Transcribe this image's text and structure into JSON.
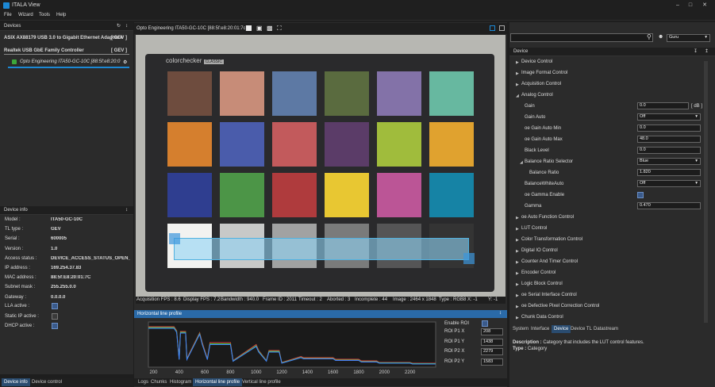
{
  "app": {
    "title": "ITALA View"
  },
  "menu": [
    "File",
    "Wizard",
    "Tools",
    "Help"
  ],
  "devices_panel": {
    "title": "Devices",
    "adapters": [
      {
        "name": "ASIX AX88179 USB 3.0 to Gigabit Ethernet Adapter #",
        "tag": "[ GEV ]"
      },
      {
        "name": "Realtek USB GbE Family Controller",
        "tag": "[ GEV ]"
      }
    ],
    "camera": "Opto Engineering ITA50-GC-10C [88:5f:e8:20:0"
  },
  "device_info": {
    "title": "Device info",
    "rows": [
      {
        "label": "Model :",
        "value": "ITA50-GC-10C"
      },
      {
        "label": "TL type :",
        "value": "GEV"
      },
      {
        "label": "Serial :",
        "value": "600005"
      },
      {
        "label": "Version :",
        "value": "1.0"
      },
      {
        "label": "Access status :",
        "value": "DEVICE_ACCESS_STATUS_OPEN_REA("
      },
      {
        "label": "IP address :",
        "value": "169.254.37.83"
      },
      {
        "label": "MAC address :",
        "value": "88:5f:E8:20:01:7C"
      },
      {
        "label": "Subnet mask :",
        "value": "255.255.0.0"
      },
      {
        "label": "Gateway :",
        "value": "0.0.0.0"
      }
    ],
    "checks": [
      {
        "label": "LLA active :",
        "checked": true
      },
      {
        "label": "Static IP active :",
        "checked": false
      },
      {
        "label": "DHCP active :",
        "checked": true
      }
    ]
  },
  "left_tabs": [
    "Device info",
    "Device control"
  ],
  "viewer": {
    "title": "Opto Engineering ITA50-GC-10C [88:5f:e8:20:01:7c]",
    "brand_text": "colorchecker",
    "brand_badge": "CLASSIC",
    "status": {
      "acq_fps": "Acquisition FPS : 8.6",
      "disp_fps": "Display FPS : 7.2",
      "bandwidth": "Bandwidth : 940.0",
      "frame_id": "Frame ID : 2011",
      "timeout": "Timeout : 2",
      "aborted": "Aborted : 3",
      "incomplete": "Incomplete : 44",
      "image": "Image : 2464 x 1848",
      "type": "Type : RGB8",
      "x": "X: -1",
      "y": "Y: -1"
    }
  },
  "profile": {
    "title": "Horizontal line profile",
    "enable_label": "Enable ROI",
    "enabled": true,
    "fields": [
      {
        "label": "ROI P1 X",
        "value": "208"
      },
      {
        "label": "ROI P1 Y",
        "value": "1438"
      },
      {
        "label": "ROI P2 X",
        "value": "2279"
      },
      {
        "label": "ROI P2 Y",
        "value": "1583"
      }
    ],
    "x_ticks": [
      "200",
      "400",
      "600",
      "800",
      "1000",
      "1200",
      "1400",
      "1600",
      "1800",
      "2000",
      "2200"
    ]
  },
  "bottom_tabs": [
    "Logs",
    "Chunks",
    "Histogram",
    "Horizontal line profile",
    "Vertical line profile"
  ],
  "right_panel": {
    "search_placeholder": "",
    "visibility": "Guru",
    "section_title": "Device",
    "categories_top": [
      "Device Control",
      "Image Format Control",
      "Acquisition Control",
      "Analog Control"
    ],
    "features": [
      {
        "label": "Gain",
        "value": "0.0",
        "unit": "[ dB ]",
        "kind": "input"
      },
      {
        "label": "Gain Auto",
        "value": "Off",
        "kind": "select"
      },
      {
        "label": "oe Gain Auto Min",
        "value": "0.0",
        "kind": "input"
      },
      {
        "label": "oe Gain Auto Max",
        "value": "48.0",
        "kind": "input"
      },
      {
        "label": "Black Level",
        "value": "0.0",
        "kind": "input"
      },
      {
        "label": "Balance Ratio Selector",
        "value": "Blue",
        "kind": "select"
      },
      {
        "label": "Balance Ratio",
        "value": "1.820",
        "kind": "input"
      },
      {
        "label": "BalanceWhiteAuto",
        "value": "Off",
        "kind": "select"
      },
      {
        "label": "oe Gamma Enable",
        "value": "",
        "kind": "check"
      },
      {
        "label": "Gamma",
        "value": "0.470",
        "kind": "input"
      }
    ],
    "categories_bottom": [
      "oe Auto Function Control",
      "LUT Control",
      "Color Transformation Control",
      "Digital IO Control",
      "Counter And Timer Control",
      "Encoder Control",
      "Logic Block Control",
      "oe Serial Interface Control",
      "oe Defective Pixel Correction Control",
      "Chunk Data Control"
    ],
    "tabs": [
      "System",
      "Interface",
      "Device",
      "Device TL",
      "Datastream"
    ],
    "description_label": "Description :",
    "description": "Category that includes the LUT control features.",
    "type_label": "Type :",
    "type": "Category"
  },
  "colors": {
    "accent": "#1c88d4",
    "panel": "#2b2b2b",
    "roi": "#8fd3f5"
  },
  "chart_data": {
    "type": "line",
    "title": "",
    "xlabel": "",
    "ylabel": "",
    "xlim": [
      160,
      2400
    ],
    "series": [
      {
        "color": "#e04040",
        "x": [
          160,
          360,
          380,
          400,
          410,
          450,
          460,
          560,
          580,
          620,
          640,
          800,
          820,
          1000,
          1020,
          1080,
          1100,
          1180,
          1200,
          1350,
          1370,
          1600,
          1620,
          1800,
          1820,
          1940,
          1960,
          2200,
          2220,
          2400
        ],
        "values": [
          100,
          100,
          90,
          20,
          88,
          88,
          20,
          85,
          60,
          20,
          60,
          60,
          15,
          55,
          40,
          15,
          40,
          40,
          10,
          25,
          22,
          22,
          18,
          18,
          14,
          14,
          10,
          10,
          8,
          8
        ]
      },
      {
        "color": "#40c040",
        "x": [
          160,
          360,
          380,
          400,
          410,
          450,
          460,
          560,
          580,
          620,
          640,
          800,
          820,
          1000,
          1020,
          1080,
          1100,
          1180,
          1200,
          1350,
          1370,
          1600,
          1620,
          1800,
          1820,
          1940,
          1960,
          2200,
          2220,
          2400
        ],
        "values": [
          98,
          98,
          88,
          18,
          86,
          86,
          18,
          83,
          57,
          18,
          57,
          57,
          14,
          52,
          38,
          14,
          38,
          38,
          9,
          23,
          20,
          20,
          16,
          16,
          12,
          12,
          9,
          9,
          7,
          7
        ]
      },
      {
        "color": "#4080ff",
        "x": [
          160,
          360,
          380,
          400,
          410,
          450,
          460,
          560,
          580,
          620,
          640,
          800,
          820,
          1000,
          1020,
          1080,
          1100,
          1180,
          1200,
          1350,
          1370,
          1600,
          1620,
          1800,
          1820,
          1940,
          1960,
          2200,
          2220,
          2400
        ],
        "values": [
          96,
          96,
          86,
          17,
          84,
          84,
          17,
          81,
          55,
          17,
          55,
          55,
          13,
          50,
          36,
          13,
          36,
          36,
          8,
          22,
          19,
          19,
          15,
          15,
          11,
          11,
          8,
          8,
          6,
          6
        ]
      }
    ]
  }
}
